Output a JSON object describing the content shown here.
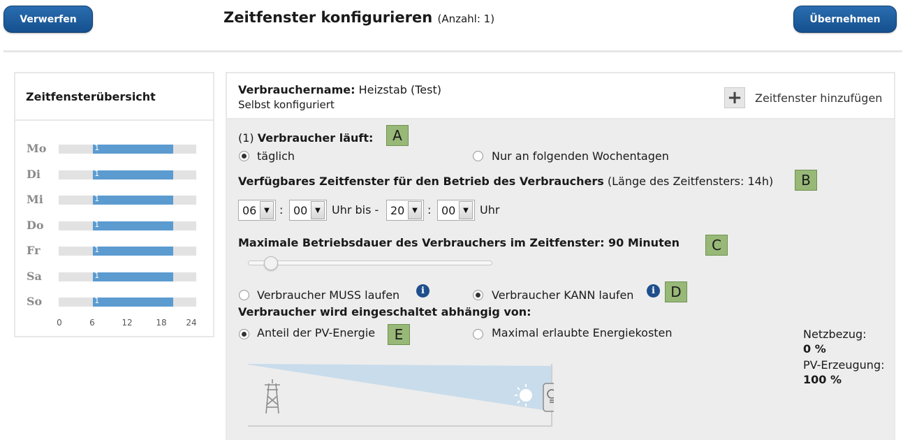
{
  "header": {
    "discard_label": "Verwerfen",
    "title": "Zeitfenster konfigurieren",
    "count": "(Anzahl: 1)",
    "apply_label": "Übernehmen"
  },
  "sidebar": {
    "title": "Zeitfensterübersicht",
    "days": [
      {
        "label": "Mo",
        "count": "1",
        "start": 6,
        "end": 20
      },
      {
        "label": "Di",
        "count": "1",
        "start": 6,
        "end": 20
      },
      {
        "label": "Mi",
        "count": "1",
        "start": 6,
        "end": 20
      },
      {
        "label": "Do",
        "count": "1",
        "start": 6,
        "end": 20
      },
      {
        "label": "Fr",
        "count": "1",
        "start": 6,
        "end": 20
      },
      {
        "label": "Sa",
        "count": "1",
        "start": 6,
        "end": 20
      },
      {
        "label": "So",
        "count": "1",
        "start": 6,
        "end": 20
      }
    ],
    "axis_ticks": [
      "0",
      "6",
      "12",
      "18",
      "24"
    ]
  },
  "main": {
    "consumer_label": "Verbrauchername:",
    "consumer_name": "Heizstab (Test)",
    "consumer_sub": "Selbst konfiguriert",
    "add_label": "Zeitfenster hinzufügen",
    "section1_prefix": "(1)",
    "section1_title": "Verbraucher läuft:",
    "option_daily": "täglich",
    "option_weekdays": "Nur an folgenden Wochentagen",
    "window_title": "Verfügbares Zeitfenster für den Betrieb des Verbrauchers",
    "window_length": "(Länge des Zeitfensters: 14h)",
    "from_hour": "06",
    "from_min": "00",
    "uhr_bis": "Uhr bis -",
    "to_hour": "20",
    "to_min": "00",
    "uhr": "Uhr",
    "separator": ":",
    "duration_title": "Maximale Betriebsdauer des Verbrauchers im Zeitfenster: 90 Minuten",
    "must_run": "Verbraucher MUSS laufen",
    "can_run": "Verbraucher KANN laufen",
    "depends_title": "Verbraucher wird eingeschaltet abhängig von:",
    "pv_share": "Anteil der PV-Energie",
    "max_cost": "Maximal erlaubte Energiekosten",
    "grid_label": "Netzbezug:",
    "grid_value": "0 %",
    "pv_label": "PV-Erzeugung:",
    "pv_value": "100 %",
    "info_glyph": "i"
  },
  "markers": {
    "a": "A",
    "b": "B",
    "c": "C",
    "d": "D",
    "e": "E"
  },
  "icons": {
    "add": "plus-icon",
    "grid": "power-tower-icon",
    "sun": "sun-icon",
    "bulb": "lightbulb-icon"
  },
  "colors": {
    "button": "#15508e",
    "bar": "#5b9bd0",
    "marker": "#98b878",
    "info": "#1f4e8c"
  }
}
